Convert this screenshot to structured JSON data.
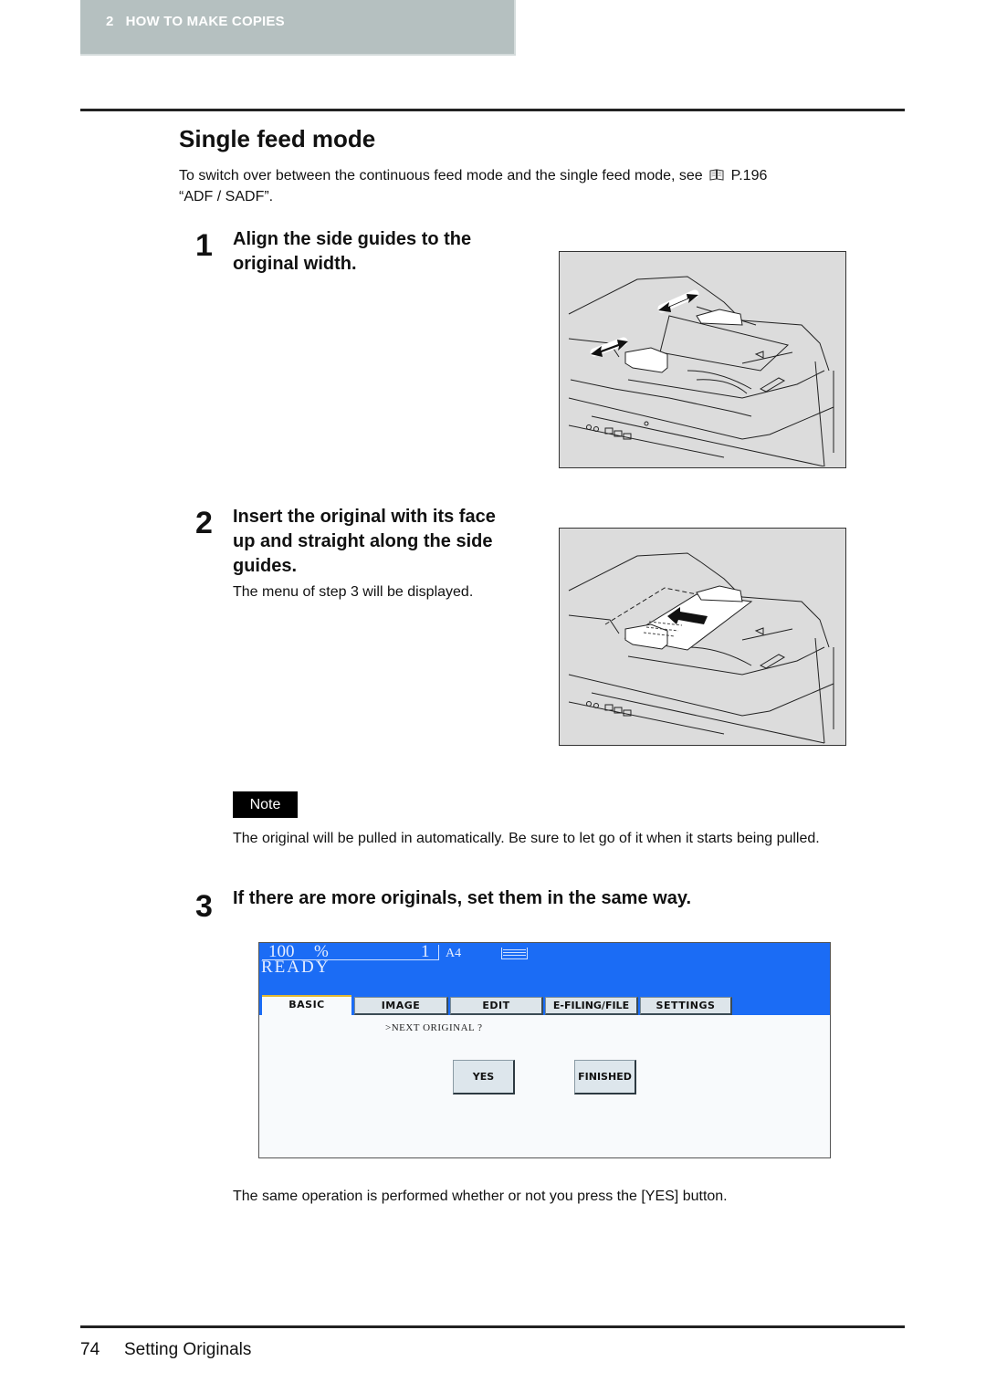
{
  "header": {
    "chapter_number": "2",
    "chapter_title": "HOW TO MAKE COPIES",
    "chapter_label": "2   HOW TO MAKE COPIES"
  },
  "section": {
    "title": "Single feed mode",
    "intro_before": "To switch over between the continuous feed mode and the single feed mode, see",
    "reference_icon": "book-icon",
    "intro_reference": "P.196",
    "intro_after": "“ADF / SADF”."
  },
  "steps": [
    {
      "number": "1",
      "heading_line1": "Align the side guides to the",
      "heading_line2": "original width.",
      "figure": "illustration-adjust-side-guides"
    },
    {
      "number": "2",
      "heading_line1": "Insert the original with its face",
      "heading_line2": "up and straight along the side",
      "heading_line3": "guides.",
      "subtext": "The menu of step 3 will be displayed.",
      "figure": "illustration-insert-original"
    },
    {
      "number": "3",
      "heading_line1": "If there are more originals, set them in the same way."
    }
  ],
  "note": {
    "badge": "Note",
    "text": "The original will be pulled in automatically. Be sure to let go of it when it starts being pulled."
  },
  "copier_panel": {
    "ratio": "100",
    "ratio_unit": "%",
    "count": "1",
    "paper_size": "A4",
    "tray_icon": "paper-tray-icon",
    "status": "READY",
    "tabs": [
      {
        "label": "BASIC",
        "active": true
      },
      {
        "label": "IMAGE",
        "active": false
      },
      {
        "label": "EDIT",
        "active": false
      },
      {
        "label": "E-FILING/FILE",
        "active": false
      },
      {
        "label": "SETTINGS",
        "active": false
      }
    ],
    "prompt": ">NEXT ORIGINAL ?",
    "buttons": {
      "yes": "YES",
      "finished": "FINISHED"
    },
    "colors": {
      "header_blue": "#1b6cf5",
      "active_tab_accent": "#e2b832",
      "button_face": "#dde6ec"
    }
  },
  "caption": "The same operation is performed whether or not you press the [YES] button.",
  "footer": {
    "page_number": "74",
    "title": "Setting Originals"
  }
}
